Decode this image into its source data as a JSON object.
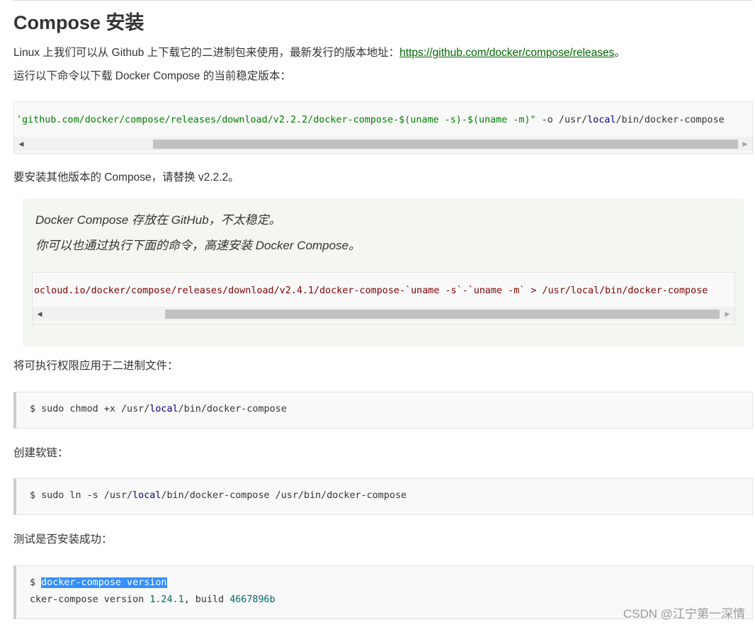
{
  "article": {
    "title": "Compose 安装",
    "intro": {
      "text": "Linux 上我们可以从 Github 上下载它的二进制包来使用，最新发行的版本地址：",
      "link": "https://github.com/docker/compose/releases",
      "suffix": "。"
    },
    "p_download": "运行以下命令以下载 Docker Compose 的当前稳定版本：",
    "code_download": {
      "s1": "'github.com/docker/compose/releases/download/v2.2.2/docker-compose-$(uname -s)-$(uname -m)\"",
      "t1": " -o /usr/",
      "kw1": "local",
      "t2": "/bin/docker-compose"
    },
    "p_other_version": "要安装其他版本的 Compose，请替换 v2.2.2。",
    "quote": {
      "line1": "Docker Compose 存放在 GitHub，不太稳定。",
      "line2": "你可以也通过执行下面的命令，高速安装 Docker Compose。",
      "code": "ocloud.io/docker/compose/releases/download/v2.4.1/docker-compose-`uname -s`-`uname -m` > /usr/local/bin/docker-compose"
    },
    "p_chmod": "将可执行权限应用于二进制文件：",
    "code_chmod": {
      "t1": "$ sudo chmod +x /usr/",
      "kw1": "local",
      "t2": "/bin/docker-compose"
    },
    "p_symlink": "创建软链：",
    "code_symlink": {
      "t1": "$ sudo ln -s /usr/",
      "kw1": "local",
      "t2": "/bin/docker-compose /usr/bin/docker-compose"
    },
    "p_test": "测试是否安装成功：",
    "code_test": {
      "prompt": "$ ",
      "command": "docker-compose version",
      "out1": "cker-compose version ",
      "version": "1.24.1",
      "out2": ", build ",
      "build": "4667896b"
    }
  },
  "watermark": "CSDN @江宁第一深情",
  "icons": {
    "scroll_left": "triangle-left",
    "scroll_right": "triangle-right"
  }
}
